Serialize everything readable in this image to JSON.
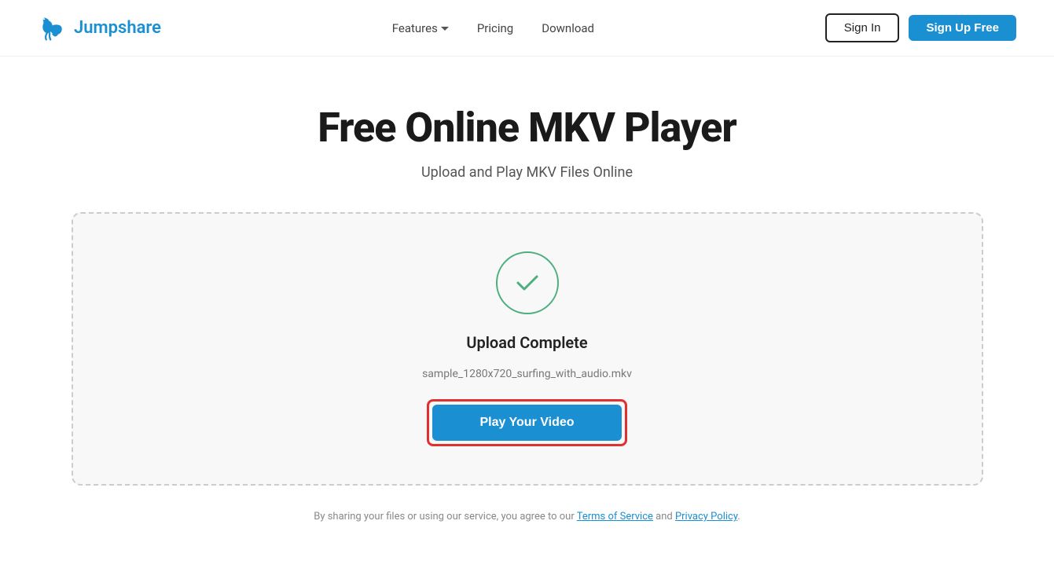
{
  "header": {
    "logo_text": "Jumpshare",
    "nav": {
      "features_label": "Features",
      "pricing_label": "Pricing",
      "download_label": "Download"
    },
    "buttons": {
      "signin_label": "Sign In",
      "signup_label": "Sign Up Free"
    }
  },
  "main": {
    "title": "Free Online MKV Player",
    "subtitle": "Upload and Play MKV Files Online"
  },
  "upload_box": {
    "status_text": "Upload Complete",
    "filename": "sample_1280x720_surfing_with_audio.mkv",
    "play_button_label": "Play Your Video"
  },
  "footer": {
    "note_text": "By sharing your files or using our service, you agree to our ",
    "tos_label": "Terms of Service",
    "and_text": " and ",
    "privacy_label": "Privacy Policy",
    "period": "."
  },
  "colors": {
    "brand_blue": "#1a8fd1",
    "check_green": "#4caf7d",
    "highlight_red": "#e03030"
  }
}
